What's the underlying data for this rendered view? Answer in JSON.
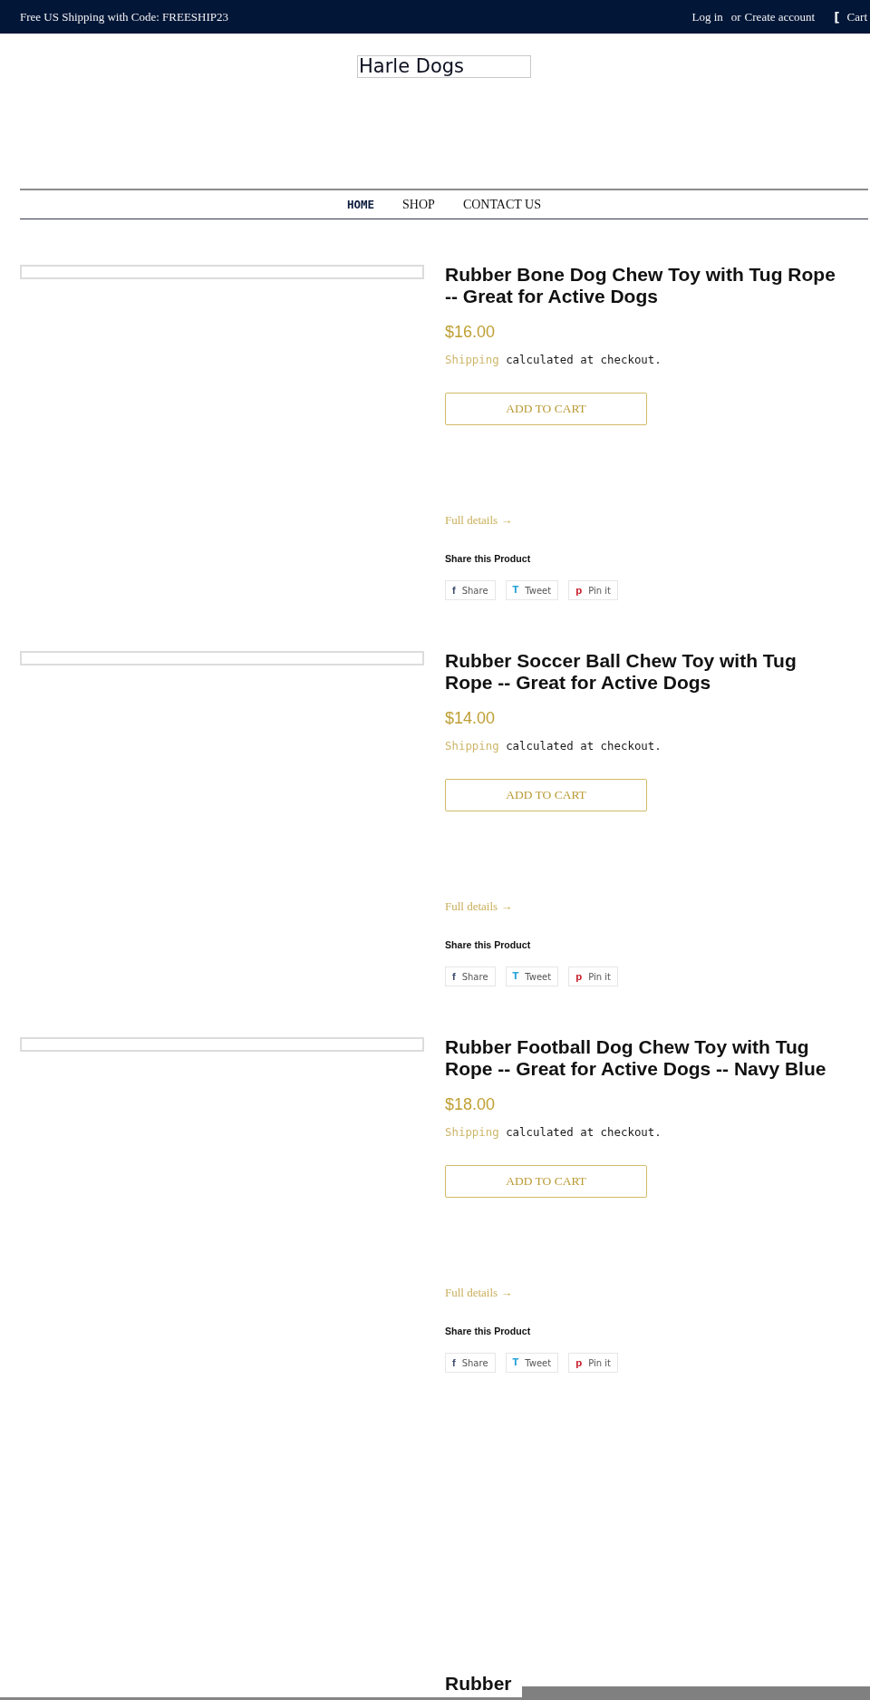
{
  "announcement_bar": {
    "message": "Free US Shipping with Code: FREESHIP23",
    "login": "Log in",
    "separator": "or",
    "create_account": "Create account",
    "cart": {
      "icon": "[",
      "label": "Cart"
    }
  },
  "logo": {
    "text": "Harle Dogs"
  },
  "nav": [
    {
      "label": "HOME",
      "selected": true
    },
    {
      "label": "SHOP",
      "selected": false
    },
    {
      "label": "CONTACT US",
      "selected": false
    }
  ],
  "products": [
    {
      "title": "Rubber Bone Dog Chew Toy with Tug Rope -- Great for Active Dogs",
      "price": "$16.00",
      "shipping": {
        "link": "Shipping",
        "text": "calculated at checkout."
      },
      "add_to_cart": "ADD TO CART",
      "details_link": "Full details →",
      "share_heading": "Share this Product",
      "share_buttons": [
        {
          "kind": "facebook",
          "icon": "f",
          "label": "Share",
          "color": "#3b4a6e"
        },
        {
          "kind": "twitter",
          "icon": "T",
          "label": "Tweet",
          "color": "#2aa4d8"
        },
        {
          "kind": "pinterest",
          "icon": "p",
          "label": "Pin it",
          "color": "#c8202d"
        }
      ]
    },
    {
      "title": "Rubber Soccer Ball Chew Toy with Tug Rope -- Great for Active Dogs",
      "price": "$14.00",
      "shipping": {
        "link": "Shipping",
        "text": "calculated at checkout."
      },
      "add_to_cart": "ADD TO CART",
      "details_link": "Full details →",
      "share_heading": "Share this Product",
      "share_buttons": [
        {
          "kind": "facebook",
          "icon": "f",
          "label": "Share",
          "color": "#3b4a6e"
        },
        {
          "kind": "twitter",
          "icon": "T",
          "label": "Tweet",
          "color": "#2aa4d8"
        },
        {
          "kind": "pinterest",
          "icon": "p",
          "label": "Pin it",
          "color": "#c8202d"
        }
      ]
    },
    {
      "title": "Rubber Football Dog Chew Toy with Tug Rope -- Great for Active Dogs -- Navy Blue",
      "price": "$18.00",
      "shipping": {
        "link": "Shipping",
        "text": "calculated at checkout."
      },
      "add_to_cart": "ADD TO CART",
      "details_link": "Full details →",
      "share_heading": "Share this Product",
      "share_buttons": [
        {
          "kind": "facebook",
          "icon": "f",
          "label": "Share",
          "color": "#3b4a6e"
        },
        {
          "kind": "twitter",
          "icon": "T",
          "label": "Tweet",
          "color": "#2aa4d8"
        },
        {
          "kind": "pinterest",
          "icon": "p",
          "label": "Pin it",
          "color": "#c8202d"
        }
      ]
    }
  ],
  "next_product": {
    "title": "Rubber"
  }
}
